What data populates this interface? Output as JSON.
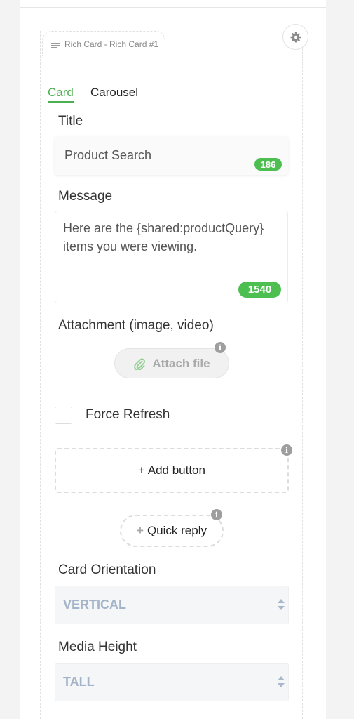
{
  "card_header": {
    "label": "Rich Card - Rich Card #1"
  },
  "tabs": [
    {
      "label": "Card",
      "active": true
    },
    {
      "label": "Carousel",
      "active": false
    }
  ],
  "title_field": {
    "label": "Title",
    "value": "Product Search",
    "remaining": "186"
  },
  "message_field": {
    "label": "Message",
    "value": "Here are the {shared:productQuery} items you were viewing.",
    "remaining": "1540"
  },
  "attachment": {
    "label": "Attachment (image, video)",
    "button_label": "Attach file"
  },
  "force_refresh": {
    "label": "Force Refresh",
    "checked": false
  },
  "add_button": {
    "label": "+ Add button"
  },
  "quick_reply": {
    "plus": "+",
    "label": "Quick reply"
  },
  "card_orientation": {
    "label": "Card Orientation",
    "value": "VERTICAL"
  },
  "media_height": {
    "label": "Media Height",
    "value": "TALL"
  },
  "colors": {
    "accent_green": "#4cbf50",
    "select_text": "#a3b3c8"
  }
}
